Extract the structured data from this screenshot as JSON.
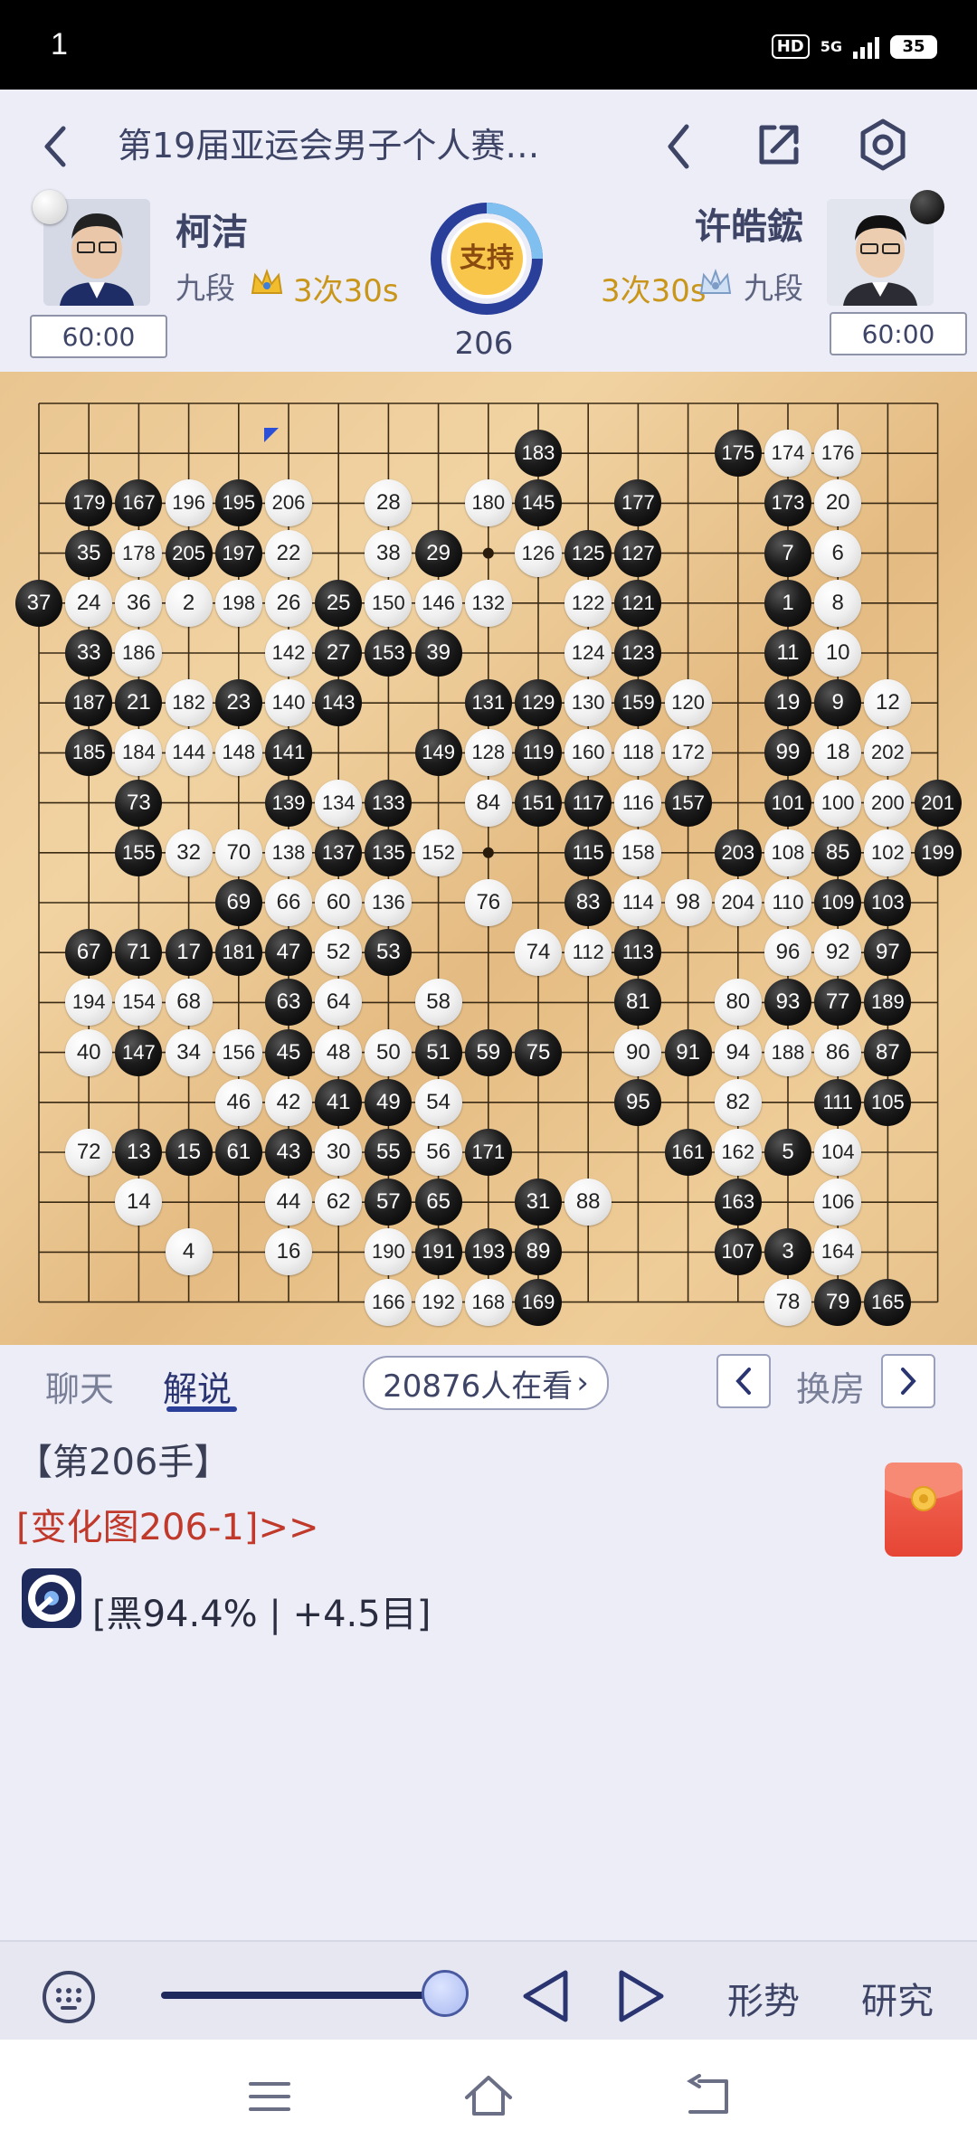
{
  "status_bar": {
    "time": "1",
    "network": "HD",
    "signal": "5G",
    "battery": "35"
  },
  "header": {
    "title": "第19届亚运会男子个人赛…",
    "left_player": {
      "name": "柯洁",
      "rank": "九段",
      "byoyomi": "3次30s",
      "clock": "60:00",
      "color": "white"
    },
    "right_player": {
      "name": "许皓鋐",
      "rank": "九段",
      "byoyomi": "3次30s",
      "clock": "60:00",
      "color": "black"
    },
    "support_label": "支持",
    "move_count": "206"
  },
  "board": {
    "size": 19,
    "last_move": "206",
    "stones": [
      {
        "c": "b",
        "n": "183",
        "col": 10,
        "row": 1
      },
      {
        "c": "b",
        "n": "175",
        "col": 14,
        "row": 1
      },
      {
        "c": "w",
        "n": "174",
        "col": 15,
        "row": 1
      },
      {
        "c": "w",
        "n": "176",
        "col": 16,
        "row": 1
      },
      {
        "c": "b",
        "n": "179",
        "col": 1,
        "row": 2
      },
      {
        "c": "b",
        "n": "167",
        "col": 2,
        "row": 2
      },
      {
        "c": "w",
        "n": "196",
        "col": 3,
        "row": 2
      },
      {
        "c": "b",
        "n": "195",
        "col": 4,
        "row": 2
      },
      {
        "c": "w",
        "n": "206",
        "col": 5,
        "row": 2
      },
      {
        "c": "w",
        "n": "28",
        "col": 7,
        "row": 2
      },
      {
        "c": "w",
        "n": "180",
        "col": 9,
        "row": 2
      },
      {
        "c": "b",
        "n": "145",
        "col": 10,
        "row": 2
      },
      {
        "c": "b",
        "n": "177",
        "col": 12,
        "row": 2
      },
      {
        "c": "b",
        "n": "173",
        "col": 15,
        "row": 2
      },
      {
        "c": "w",
        "n": "20",
        "col": 16,
        "row": 2
      },
      {
        "c": "b",
        "n": "35",
        "col": 1,
        "row": 3
      },
      {
        "c": "w",
        "n": "178",
        "col": 2,
        "row": 3
      },
      {
        "c": "b",
        "n": "205",
        "col": 3,
        "row": 3
      },
      {
        "c": "b",
        "n": "197",
        "col": 4,
        "row": 3
      },
      {
        "c": "w",
        "n": "22",
        "col": 5,
        "row": 3
      },
      {
        "c": "w",
        "n": "38",
        "col": 7,
        "row": 3
      },
      {
        "c": "b",
        "n": "29",
        "col": 8,
        "row": 3
      },
      {
        "c": "w",
        "n": "126",
        "col": 10,
        "row": 3
      },
      {
        "c": "b",
        "n": "125",
        "col": 11,
        "row": 3
      },
      {
        "c": "b",
        "n": "127",
        "col": 12,
        "row": 3
      },
      {
        "c": "b",
        "n": "7",
        "col": 15,
        "row": 3
      },
      {
        "c": "w",
        "n": "6",
        "col": 16,
        "row": 3
      },
      {
        "c": "b",
        "n": "37",
        "col": 0,
        "row": 4
      },
      {
        "c": "w",
        "n": "24",
        "col": 1,
        "row": 4
      },
      {
        "c": "w",
        "n": "36",
        "col": 2,
        "row": 4
      },
      {
        "c": "w",
        "n": "2",
        "col": 3,
        "row": 4
      },
      {
        "c": "w",
        "n": "198",
        "col": 4,
        "row": 4
      },
      {
        "c": "w",
        "n": "26",
        "col": 5,
        "row": 4
      },
      {
        "c": "b",
        "n": "25",
        "col": 6,
        "row": 4
      },
      {
        "c": "w",
        "n": "150",
        "col": 7,
        "row": 4
      },
      {
        "c": "w",
        "n": "146",
        "col": 8,
        "row": 4
      },
      {
        "c": "w",
        "n": "132",
        "col": 9,
        "row": 4
      },
      {
        "c": "w",
        "n": "122",
        "col": 11,
        "row": 4
      },
      {
        "c": "b",
        "n": "121",
        "col": 12,
        "row": 4
      },
      {
        "c": "b",
        "n": "1",
        "col": 15,
        "row": 4
      },
      {
        "c": "w",
        "n": "8",
        "col": 16,
        "row": 4
      },
      {
        "c": "b",
        "n": "33",
        "col": 1,
        "row": 5
      },
      {
        "c": "w",
        "n": "186",
        "col": 2,
        "row": 5
      },
      {
        "c": "w",
        "n": "142",
        "col": 5,
        "row": 5
      },
      {
        "c": "b",
        "n": "27",
        "col": 6,
        "row": 5
      },
      {
        "c": "b",
        "n": "153",
        "col": 7,
        "row": 5
      },
      {
        "c": "b",
        "n": "39",
        "col": 8,
        "row": 5
      },
      {
        "c": "w",
        "n": "124",
        "col": 11,
        "row": 5
      },
      {
        "c": "b",
        "n": "123",
        "col": 12,
        "row": 5
      },
      {
        "c": "b",
        "n": "11",
        "col": 15,
        "row": 5
      },
      {
        "c": "w",
        "n": "10",
        "col": 16,
        "row": 5
      },
      {
        "c": "b",
        "n": "187",
        "col": 1,
        "row": 6
      },
      {
        "c": "b",
        "n": "21",
        "col": 2,
        "row": 6
      },
      {
        "c": "w",
        "n": "182",
        "col": 3,
        "row": 6
      },
      {
        "c": "b",
        "n": "23",
        "col": 4,
        "row": 6
      },
      {
        "c": "w",
        "n": "140",
        "col": 5,
        "row": 6
      },
      {
        "c": "b",
        "n": "143",
        "col": 6,
        "row": 6
      },
      {
        "c": "b",
        "n": "131",
        "col": 9,
        "row": 6
      },
      {
        "c": "b",
        "n": "129",
        "col": 10,
        "row": 6
      },
      {
        "c": "w",
        "n": "130",
        "col": 11,
        "row": 6
      },
      {
        "c": "b",
        "n": "159",
        "col": 12,
        "row": 6
      },
      {
        "c": "w",
        "n": "120",
        "col": 13,
        "row": 6
      },
      {
        "c": "b",
        "n": "19",
        "col": 15,
        "row": 6
      },
      {
        "c": "b",
        "n": "9",
        "col": 16,
        "row": 6
      },
      {
        "c": "w",
        "n": "12",
        "col": 17,
        "row": 6
      },
      {
        "c": "b",
        "n": "185",
        "col": 1,
        "row": 7
      },
      {
        "c": "w",
        "n": "184",
        "col": 2,
        "row": 7
      },
      {
        "c": "w",
        "n": "144",
        "col": 3,
        "row": 7
      },
      {
        "c": "w",
        "n": "148",
        "col": 4,
        "row": 7
      },
      {
        "c": "b",
        "n": "141",
        "col": 5,
        "row": 7
      },
      {
        "c": "b",
        "n": "149",
        "col": 8,
        "row": 7
      },
      {
        "c": "w",
        "n": "128",
        "col": 9,
        "row": 7
      },
      {
        "c": "b",
        "n": "119",
        "col": 10,
        "row": 7
      },
      {
        "c": "w",
        "n": "160",
        "col": 11,
        "row": 7
      },
      {
        "c": "w",
        "n": "118",
        "col": 12,
        "row": 7
      },
      {
        "c": "w",
        "n": "172",
        "col": 13,
        "row": 7
      },
      {
        "c": "b",
        "n": "99",
        "col": 15,
        "row": 7
      },
      {
        "c": "w",
        "n": "18",
        "col": 16,
        "row": 7
      },
      {
        "c": "w",
        "n": "202",
        "col": 17,
        "row": 7
      },
      {
        "c": "b",
        "n": "73",
        "col": 2,
        "row": 8
      },
      {
        "c": "b",
        "n": "139",
        "col": 5,
        "row": 8
      },
      {
        "c": "w",
        "n": "134",
        "col": 6,
        "row": 8
      },
      {
        "c": "b",
        "n": "133",
        "col": 7,
        "row": 8
      },
      {
        "c": "w",
        "n": "84",
        "col": 9,
        "row": 8
      },
      {
        "c": "b",
        "n": "151",
        "col": 10,
        "row": 8
      },
      {
        "c": "b",
        "n": "117",
        "col": 11,
        "row": 8
      },
      {
        "c": "w",
        "n": "116",
        "col": 12,
        "row": 8
      },
      {
        "c": "b",
        "n": "157",
        "col": 13,
        "row": 8
      },
      {
        "c": "b",
        "n": "101",
        "col": 15,
        "row": 8
      },
      {
        "c": "w",
        "n": "100",
        "col": 16,
        "row": 8
      },
      {
        "c": "w",
        "n": "200",
        "col": 17,
        "row": 8
      },
      {
        "c": "b",
        "n": "201",
        "col": 18,
        "row": 8
      },
      {
        "c": "b",
        "n": "155",
        "col": 2,
        "row": 9
      },
      {
        "c": "w",
        "n": "32",
        "col": 3,
        "row": 9
      },
      {
        "c": "w",
        "n": "70",
        "col": 4,
        "row": 9
      },
      {
        "c": "w",
        "n": "138",
        "col": 5,
        "row": 9
      },
      {
        "c": "b",
        "n": "137",
        "col": 6,
        "row": 9
      },
      {
        "c": "b",
        "n": "135",
        "col": 7,
        "row": 9
      },
      {
        "c": "w",
        "n": "152",
        "col": 8,
        "row": 9
      },
      {
        "c": "b",
        "n": "115",
        "col": 11,
        "row": 9
      },
      {
        "c": "w",
        "n": "158",
        "col": 12,
        "row": 9
      },
      {
        "c": "b",
        "n": "203",
        "col": 14,
        "row": 9
      },
      {
        "c": "w",
        "n": "108",
        "col": 15,
        "row": 9
      },
      {
        "c": "b",
        "n": "85",
        "col": 16,
        "row": 9
      },
      {
        "c": "w",
        "n": "102",
        "col": 17,
        "row": 9
      },
      {
        "c": "b",
        "n": "199",
        "col": 18,
        "row": 9
      },
      {
        "c": "b",
        "n": "69",
        "col": 4,
        "row": 10
      },
      {
        "c": "w",
        "n": "66",
        "col": 5,
        "row": 10
      },
      {
        "c": "w",
        "n": "60",
        "col": 6,
        "row": 10
      },
      {
        "c": "w",
        "n": "136",
        "col": 7,
        "row": 10
      },
      {
        "c": "w",
        "n": "76",
        "col": 9,
        "row": 10
      },
      {
        "c": "b",
        "n": "83",
        "col": 11,
        "row": 10
      },
      {
        "c": "w",
        "n": "114",
        "col": 12,
        "row": 10
      },
      {
        "c": "w",
        "n": "98",
        "col": 13,
        "row": 10
      },
      {
        "c": "w",
        "n": "204",
        "col": 14,
        "row": 10
      },
      {
        "c": "w",
        "n": "110",
        "col": 15,
        "row": 10
      },
      {
        "c": "b",
        "n": "109",
        "col": 16,
        "row": 10
      },
      {
        "c": "b",
        "n": "103",
        "col": 17,
        "row": 10
      },
      {
        "c": "b",
        "n": "67",
        "col": 1,
        "row": 11
      },
      {
        "c": "b",
        "n": "71",
        "col": 2,
        "row": 11
      },
      {
        "c": "b",
        "n": "17",
        "col": 3,
        "row": 11
      },
      {
        "c": "b",
        "n": "181",
        "col": 4,
        "row": 11
      },
      {
        "c": "b",
        "n": "47",
        "col": 5,
        "row": 11
      },
      {
        "c": "w",
        "n": "52",
        "col": 6,
        "row": 11
      },
      {
        "c": "b",
        "n": "53",
        "col": 7,
        "row": 11
      },
      {
        "c": "w",
        "n": "74",
        "col": 10,
        "row": 11
      },
      {
        "c": "w",
        "n": "112",
        "col": 11,
        "row": 11
      },
      {
        "c": "b",
        "n": "113",
        "col": 12,
        "row": 11
      },
      {
        "c": "w",
        "n": "96",
        "col": 15,
        "row": 11
      },
      {
        "c": "w",
        "n": "92",
        "col": 16,
        "row": 11
      },
      {
        "c": "b",
        "n": "97",
        "col": 17,
        "row": 11
      },
      {
        "c": "w",
        "n": "194",
        "col": 1,
        "row": 12
      },
      {
        "c": "w",
        "n": "154",
        "col": 2,
        "row": 12
      },
      {
        "c": "w",
        "n": "68",
        "col": 3,
        "row": 12
      },
      {
        "c": "b",
        "n": "63",
        "col": 5,
        "row": 12
      },
      {
        "c": "w",
        "n": "64",
        "col": 6,
        "row": 12
      },
      {
        "c": "w",
        "n": "58",
        "col": 8,
        "row": 12
      },
      {
        "c": "b",
        "n": "81",
        "col": 12,
        "row": 12
      },
      {
        "c": "w",
        "n": "80",
        "col": 14,
        "row": 12
      },
      {
        "c": "b",
        "n": "93",
        "col": 15,
        "row": 12
      },
      {
        "c": "b",
        "n": "77",
        "col": 16,
        "row": 12
      },
      {
        "c": "b",
        "n": "189",
        "col": 17,
        "row": 12
      },
      {
        "c": "w",
        "n": "40",
        "col": 1,
        "row": 13
      },
      {
        "c": "b",
        "n": "147",
        "col": 2,
        "row": 13
      },
      {
        "c": "w",
        "n": "34",
        "col": 3,
        "row": 13
      },
      {
        "c": "w",
        "n": "156",
        "col": 4,
        "row": 13
      },
      {
        "c": "b",
        "n": "45",
        "col": 5,
        "row": 13
      },
      {
        "c": "w",
        "n": "48",
        "col": 6,
        "row": 13
      },
      {
        "c": "w",
        "n": "50",
        "col": 7,
        "row": 13
      },
      {
        "c": "b",
        "n": "51",
        "col": 8,
        "row": 13
      },
      {
        "c": "b",
        "n": "59",
        "col": 9,
        "row": 13
      },
      {
        "c": "b",
        "n": "75",
        "col": 10,
        "row": 13
      },
      {
        "c": "w",
        "n": "90",
        "col": 12,
        "row": 13
      },
      {
        "c": "b",
        "n": "91",
        "col": 13,
        "row": 13
      },
      {
        "c": "w",
        "n": "94",
        "col": 14,
        "row": 13
      },
      {
        "c": "w",
        "n": "188",
        "col": 15,
        "row": 13
      },
      {
        "c": "w",
        "n": "86",
        "col": 16,
        "row": 13
      },
      {
        "c": "b",
        "n": "87",
        "col": 17,
        "row": 13
      },
      {
        "c": "w",
        "n": "46",
        "col": 4,
        "row": 14
      },
      {
        "c": "w",
        "n": "42",
        "col": 5,
        "row": 14
      },
      {
        "c": "b",
        "n": "41",
        "col": 6,
        "row": 14
      },
      {
        "c": "b",
        "n": "49",
        "col": 7,
        "row": 14
      },
      {
        "c": "w",
        "n": "54",
        "col": 8,
        "row": 14
      },
      {
        "c": "b",
        "n": "95",
        "col": 12,
        "row": 14
      },
      {
        "c": "w",
        "n": "82",
        "col": 14,
        "row": 14
      },
      {
        "c": "b",
        "n": "111",
        "col": 16,
        "row": 14
      },
      {
        "c": "b",
        "n": "105",
        "col": 17,
        "row": 14
      },
      {
        "c": "w",
        "n": "72",
        "col": 1,
        "row": 15
      },
      {
        "c": "b",
        "n": "13",
        "col": 2,
        "row": 15
      },
      {
        "c": "b",
        "n": "15",
        "col": 3,
        "row": 15
      },
      {
        "c": "b",
        "n": "61",
        "col": 4,
        "row": 15
      },
      {
        "c": "b",
        "n": "43",
        "col": 5,
        "row": 15
      },
      {
        "c": "w",
        "n": "30",
        "col": 6,
        "row": 15
      },
      {
        "c": "b",
        "n": "55",
        "col": 7,
        "row": 15
      },
      {
        "c": "w",
        "n": "56",
        "col": 8,
        "row": 15
      },
      {
        "c": "b",
        "n": "171",
        "col": 9,
        "row": 15
      },
      {
        "c": "b",
        "n": "161",
        "col": 13,
        "row": 15
      },
      {
        "c": "w",
        "n": "162",
        "col": 14,
        "row": 15
      },
      {
        "c": "b",
        "n": "5",
        "col": 15,
        "row": 15
      },
      {
        "c": "w",
        "n": "104",
        "col": 16,
        "row": 15
      },
      {
        "c": "w",
        "n": "14",
        "col": 2,
        "row": 16
      },
      {
        "c": "w",
        "n": "44",
        "col": 5,
        "row": 16
      },
      {
        "c": "w",
        "n": "62",
        "col": 6,
        "row": 16
      },
      {
        "c": "b",
        "n": "57",
        "col": 7,
        "row": 16
      },
      {
        "c": "b",
        "n": "65",
        "col": 8,
        "row": 16
      },
      {
        "c": "b",
        "n": "31",
        "col": 10,
        "row": 16
      },
      {
        "c": "w",
        "n": "88",
        "col": 11,
        "row": 16
      },
      {
        "c": "b",
        "n": "163",
        "col": 14,
        "row": 16
      },
      {
        "c": "w",
        "n": "106",
        "col": 16,
        "row": 16
      },
      {
        "c": "w",
        "n": "4",
        "col": 3,
        "row": 17
      },
      {
        "c": "w",
        "n": "16",
        "col": 5,
        "row": 17
      },
      {
        "c": "w",
        "n": "190",
        "col": 7,
        "row": 17
      },
      {
        "c": "b",
        "n": "191",
        "col": 8,
        "row": 17
      },
      {
        "c": "b",
        "n": "193",
        "col": 9,
        "row": 17
      },
      {
        "c": "b",
        "n": "89",
        "col": 10,
        "row": 17
      },
      {
        "c": "b",
        "n": "107",
        "col": 14,
        "row": 17
      },
      {
        "c": "b",
        "n": "3",
        "col": 15,
        "row": 17
      },
      {
        "c": "w",
        "n": "164",
        "col": 16,
        "row": 17
      },
      {
        "c": "w",
        "n": "166",
        "col": 7,
        "row": 18
      },
      {
        "c": "w",
        "n": "192",
        "col": 8,
        "row": 18
      },
      {
        "c": "w",
        "n": "168",
        "col": 9,
        "row": 18
      },
      {
        "c": "b",
        "n": "169",
        "col": 10,
        "row": 18
      },
      {
        "c": "w",
        "n": "78",
        "col": 15,
        "row": 18
      },
      {
        "c": "b",
        "n": "79",
        "col": 16,
        "row": 18
      },
      {
        "c": "b",
        "n": "165",
        "col": 17,
        "row": 18
      }
    ]
  },
  "tabs": {
    "chat": "聊天",
    "commentary": "解说",
    "viewers": "20876人在看",
    "switch_room": "换房"
  },
  "commentary": {
    "move_title": "【第206手】",
    "variation_link": "[变化图206-1]>>",
    "ai_eval": "[黑94.4% | +4.5目]"
  },
  "toolbar": {
    "position_label": "形势",
    "study_label": "研究",
    "progress": 1.0
  },
  "colors": {
    "accent_blue": "#2b4fd6",
    "dark_blue": "#1e2a5c",
    "gold": "#c9961a",
    "red_link": "#c0392b",
    "orange": "#e8a317"
  }
}
